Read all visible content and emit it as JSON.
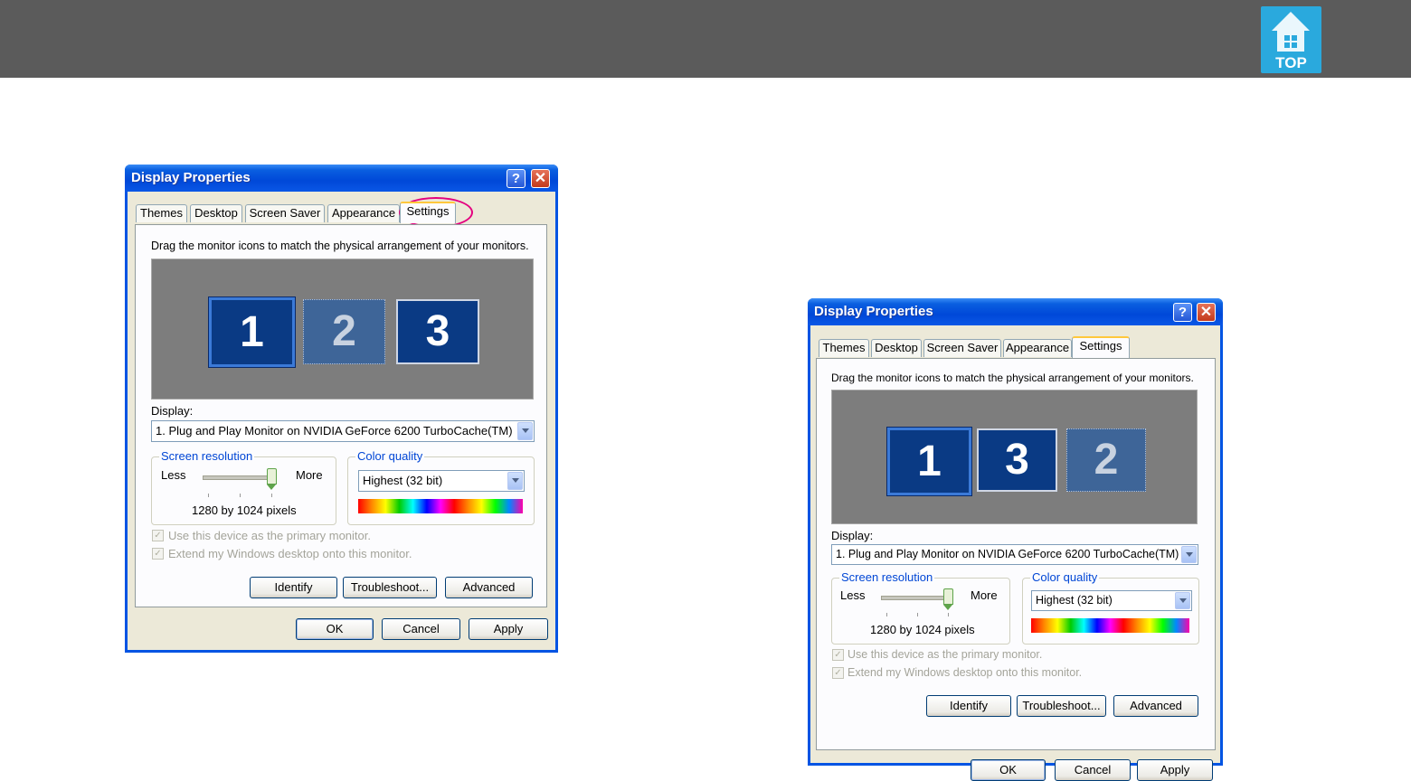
{
  "header": {
    "top_label": "TOP"
  },
  "dialog": {
    "title": "Display Properties",
    "help_glyph": "?",
    "close_glyph": "✕",
    "tabs": [
      "Themes",
      "Desktop",
      "Screen Saver",
      "Appearance",
      "Settings"
    ],
    "instruction": "Drag the monitor icons to match the physical arrangement of your monitors.",
    "display_label": "Display:",
    "display_value": "1. Plug and Play Monitor on NVIDIA GeForce 6200 TurboCache(TM)",
    "screen_resolution": {
      "title": "Screen resolution",
      "less": "Less",
      "more": "More",
      "value": "1280 by 1024 pixels"
    },
    "color_quality": {
      "title": "Color quality",
      "value": "Highest (32 bit)"
    },
    "primary_monitor": "Use this device as the primary monitor.",
    "extend_desktop": "Extend my Windows desktop onto this monitor.",
    "buttons": {
      "identify": "Identify",
      "troubleshoot": "Troubleshoot...",
      "advanced": "Advanced",
      "ok": "OK",
      "cancel": "Cancel",
      "apply": "Apply"
    }
  },
  "dialog_left": {
    "monitors": [
      "1",
      "2",
      "3"
    ]
  },
  "dialog_right": {
    "monitors": [
      "1",
      "3",
      "2"
    ]
  },
  "colors": {
    "highlight": "#e4007f",
    "top_button": "#2aa9dd",
    "header_bar": "#5b5b5b"
  }
}
